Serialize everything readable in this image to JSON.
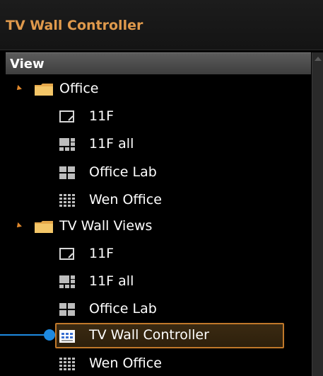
{
  "window": {
    "title": "TV Wall Controller"
  },
  "section": {
    "label": "View"
  },
  "tree": {
    "groups": [
      {
        "label": "Office",
        "items": [
          {
            "label": "11F",
            "icon": "single-screen-icon"
          },
          {
            "label": "11F all",
            "icon": "grid-mixed-icon"
          },
          {
            "label": "Office Lab",
            "icon": "grid-2x2-icon"
          },
          {
            "label": "Wen Office",
            "icon": "grid-4x4-icon"
          }
        ]
      },
      {
        "label": "TV Wall Views",
        "items": [
          {
            "label": "11F",
            "icon": "single-screen-icon"
          },
          {
            "label": "11F all",
            "icon": "grid-mixed-icon"
          },
          {
            "label": "Office Lab",
            "icon": "grid-2x2-icon"
          },
          {
            "label": "TV Wall Controller",
            "icon": "tv-wall-controller-icon",
            "selected": true
          },
          {
            "label": "Wen Office",
            "icon": "grid-4x4-icon"
          }
        ]
      }
    ]
  },
  "colors": {
    "title": "#e09a4c",
    "accent": "#e0882c",
    "selection_border": "#c0782a",
    "callout": "#1e8ae0"
  }
}
